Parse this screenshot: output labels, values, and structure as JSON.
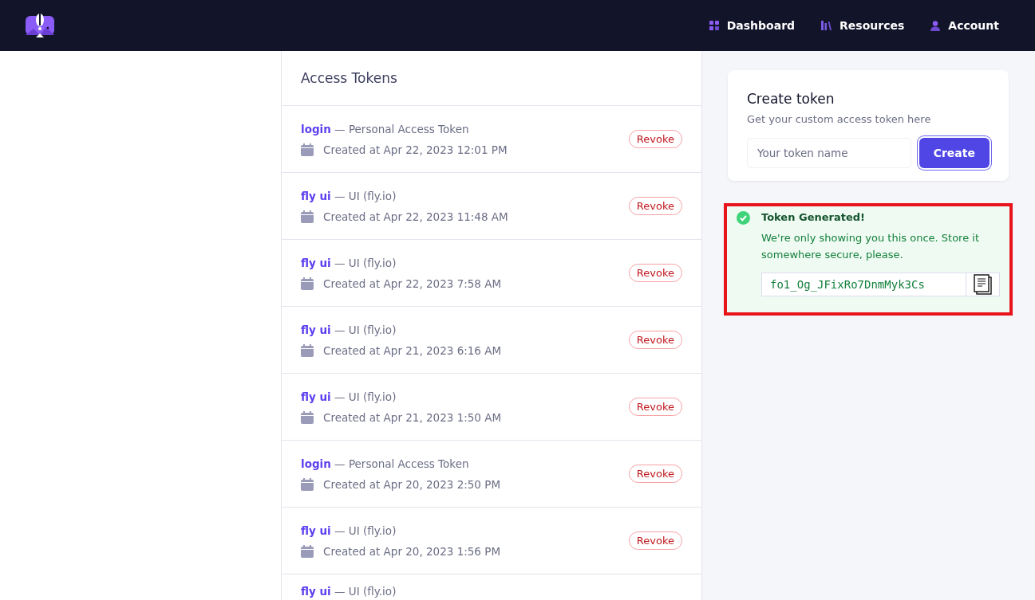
{
  "nav": [
    {
      "label": "Dashboard"
    },
    {
      "label": "Resources"
    },
    {
      "label": "Account"
    }
  ],
  "tokens": {
    "title": "Access Tokens",
    "rows": [
      {
        "name": "login",
        "type": "— Personal Access Token",
        "created": "Created at Apr 22, 2023 12:01 PM",
        "action": "Revoke"
      },
      {
        "name": "fly ui",
        "type": "— UI (fly.io)",
        "created": "Created at Apr 22, 2023 11:48 AM",
        "action": "Revoke"
      },
      {
        "name": "fly ui",
        "type": "— UI (fly.io)",
        "created": "Created at Apr 22, 2023 7:58 AM",
        "action": "Revoke"
      },
      {
        "name": "fly ui",
        "type": "— UI (fly.io)",
        "created": "Created at Apr 21, 2023 6:16 AM",
        "action": "Revoke"
      },
      {
        "name": "fly ui",
        "type": "— UI (fly.io)",
        "created": "Created at Apr 21, 2023 1:50 AM",
        "action": "Revoke"
      },
      {
        "name": "login",
        "type": "— Personal Access Token",
        "created": "Created at Apr 20, 2023 2:50 PM",
        "action": "Revoke"
      },
      {
        "name": "fly ui",
        "type": "— UI (fly.io)",
        "created": "Created at Apr 20, 2023 1:56 PM",
        "action": "Revoke"
      },
      {
        "name": "fly ui",
        "type": "— UI (fly.io)"
      }
    ]
  },
  "create": {
    "title": "Create token",
    "subtitle": "Get your custom access token here",
    "placeholder": "Your token name",
    "button": "Create"
  },
  "alert": {
    "title": "Token Generated!",
    "message": "We're only showing you this once. Store it somewhere secure, please.",
    "token": "fo1_Og_JFixRo7DnmMyk3Cs",
    "highlighted": true
  }
}
